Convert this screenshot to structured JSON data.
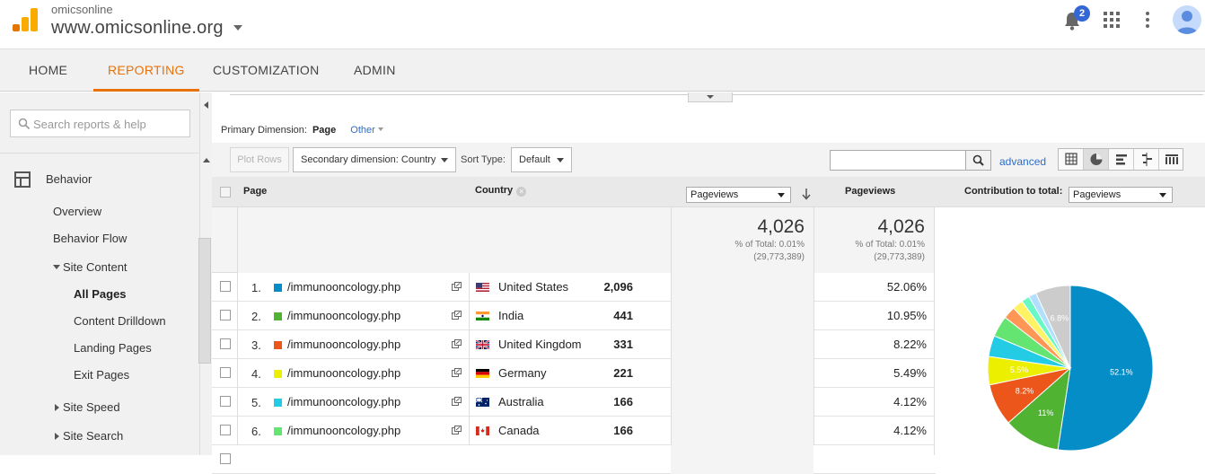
{
  "header": {
    "account_label": "omicsonline",
    "property_name": "www.omicsonline.org",
    "notification_count": "2",
    "logo_colors": [
      "#f9ab00",
      "#e37400"
    ]
  },
  "nav": {
    "tabs": [
      {
        "label": "HOME",
        "active": false
      },
      {
        "label": "REPORTING",
        "active": true
      },
      {
        "label": "CUSTOMIZATION",
        "active": false
      },
      {
        "label": "ADMIN",
        "active": false
      }
    ],
    "accent_color": "#e8710a"
  },
  "sidebar": {
    "search_placeholder": "Search reports & help",
    "section": "Behavior",
    "items": [
      {
        "label": "Overview"
      },
      {
        "label": "Behavior Flow"
      },
      {
        "label": "Site Content",
        "expanded": true
      },
      {
        "label": "All Pages",
        "selected": true
      },
      {
        "label": "Content Drilldown"
      },
      {
        "label": "Landing Pages"
      },
      {
        "label": "Exit Pages"
      },
      {
        "label": "Site Speed",
        "expanded": false
      },
      {
        "label": "Site Search",
        "expanded": false
      }
    ]
  },
  "report": {
    "primary_dimension_label": "Primary Dimension:",
    "primary_dimension_value": "Page",
    "other_label": "Other",
    "plot_rows_label": "Plot Rows",
    "secondary_dimension_label": "Secondary dimension: Country",
    "sort_type_label": "Sort Type:",
    "sort_type_value": "Default",
    "search_value": "",
    "advanced_label": "advanced",
    "columns": {
      "page": "Page",
      "country": "Country",
      "metric_select": "Pageviews",
      "pageviews": "Pageviews",
      "contribution_label": "Contribution to total:",
      "contribution_select": "Pageviews"
    },
    "totals": [
      {
        "value": "4,026",
        "pct": "% of Total: 0.01%",
        "of_total": "(29,773,389)"
      },
      {
        "value": "4,026",
        "pct": "% of Total: 0.01%",
        "of_total": "(29,773,389)"
      }
    ],
    "rows": [
      {
        "num": "1.",
        "color": "#058dc7",
        "page": "/immunooncology.php",
        "flag": "us",
        "country": "United States",
        "pageviews": "2,096",
        "pct": "52.06%"
      },
      {
        "num": "2.",
        "color": "#50b432",
        "page": "/immunooncology.php",
        "flag": "in",
        "country": "India",
        "pageviews": "441",
        "pct": "10.95%"
      },
      {
        "num": "3.",
        "color": "#ed561b",
        "page": "/immunooncology.php",
        "flag": "gb",
        "country": "United Kingdom",
        "pageviews": "331",
        "pct": "8.22%"
      },
      {
        "num": "4.",
        "color": "#edef00",
        "page": "/immunooncology.php",
        "flag": "de",
        "country": "Germany",
        "pageviews": "221",
        "pct": "5.49%"
      },
      {
        "num": "5.",
        "color": "#24cbe5",
        "page": "/immunooncology.php",
        "flag": "au",
        "country": "Australia",
        "pageviews": "166",
        "pct": "4.12%"
      },
      {
        "num": "6.",
        "color": "#64e572",
        "page": "/immunooncology.php",
        "flag": "ca",
        "country": "Canada",
        "pageviews": "166",
        "pct": "4.12%"
      }
    ]
  },
  "chart_data": {
    "type": "pie",
    "slices": [
      {
        "value": 52.1,
        "color": "#058dc7",
        "label": "52.1%"
      },
      {
        "value": 11.0,
        "color": "#50b432",
        "label": "11%"
      },
      {
        "value": 8.2,
        "color": "#ed561b",
        "label": "8.2%"
      },
      {
        "value": 5.5,
        "color": "#edef00",
        "label": "5.5%"
      },
      {
        "value": 4.1,
        "color": "#24cbe5",
        "label": ""
      },
      {
        "value": 4.1,
        "color": "#64e572",
        "label": ""
      },
      {
        "value": 2.4,
        "color": "#ff9655",
        "label": ""
      },
      {
        "value": 2.1,
        "color": "#fff263",
        "label": ""
      },
      {
        "value": 1.6,
        "color": "#6af9c4",
        "label": ""
      },
      {
        "value": 1.5,
        "color": "#b2deff",
        "label": ""
      },
      {
        "value": 6.8,
        "color": "#cccccc",
        "label": "6.8%"
      }
    ]
  }
}
